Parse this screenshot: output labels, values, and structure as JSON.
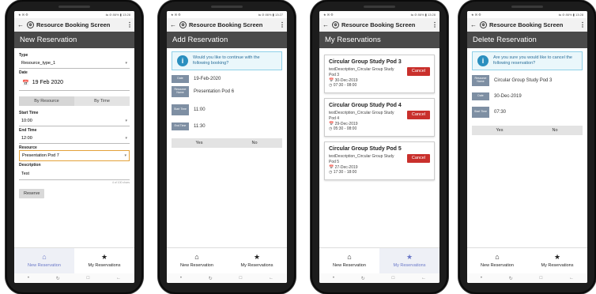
{
  "app": {
    "title": "Resource Booking Screen"
  },
  "status": {
    "left": "★ ✉ ⚙",
    "right": "⇋ ⊘ 86% ▮ 13:28"
  },
  "status2": {
    "right": "⇋ ⊘ 86% ▮ 13:27"
  },
  "nav": {
    "new": "New Reservation",
    "my": "My Reservations"
  },
  "screen1": {
    "header": "New Reservation",
    "type_label": "Type",
    "type_value": "Resource_type_1",
    "date_label": "Date",
    "date_value": "19 Feb 2020",
    "by_resource": "By Resource",
    "by_time": "By Time",
    "start_label": "Start Time",
    "start_value": "10:00",
    "end_label": "End Time",
    "end_value": "12:00",
    "resource_label": "Resource",
    "resource_value": "Presentation Pod 7",
    "desc_label": "Description",
    "desc_value": "Test",
    "counter": "4 of 100 chars",
    "reserve": "Reserve"
  },
  "screen2": {
    "header": "Add Reservation",
    "msg": "Would you like to continue with the following booking?",
    "rows": [
      {
        "tag": "Date",
        "value": "19-Feb-2020"
      },
      {
        "tag": "Resource Name",
        "value": "Presentation Pod 6"
      },
      {
        "tag": "Start Time",
        "value": "11:00"
      },
      {
        "tag": "End Time",
        "value": "11:30"
      }
    ],
    "yes": "Yes",
    "no": "No"
  },
  "screen3": {
    "header": "My Reservations",
    "cancel": "Cancel",
    "cards": [
      {
        "title": "Circular Group Study Pod 3",
        "desc": "testDescription_Circular Group Study Pod 3",
        "date": "30-Dec-2019",
        "time": "07:30 - 08:00"
      },
      {
        "title": "Circular Group Study Pod 4",
        "desc": "testDescription_Circular Group Study Pod 4",
        "date": "29-Dec-2019",
        "time": "05:30 - 08:00"
      },
      {
        "title": "Circular Group Study Pod 5",
        "desc": "testDescription_Circular Group Study Pod 5",
        "date": "27-Dec-2019",
        "time": "17:30 - 18:00"
      }
    ]
  },
  "screen4": {
    "header": "Delete Reservation",
    "msg": "Are you sure you would like to cancel the following reservation?",
    "rows": [
      {
        "tag": "Resource Name",
        "value": "Circular Group Study Pod 3"
      },
      {
        "tag": "Date",
        "value": "30-Dec-2019"
      },
      {
        "tag": "Start Time",
        "value": "07:30"
      }
    ],
    "yes": "Yes",
    "no": "No"
  },
  "icons": {
    "back": "arrow-left-icon",
    "menu": "more-vert-icon",
    "home": "home-icon",
    "star": "star-icon",
    "info": "info-icon",
    "calendar": "calendar-icon",
    "clock": "clock-icon"
  }
}
